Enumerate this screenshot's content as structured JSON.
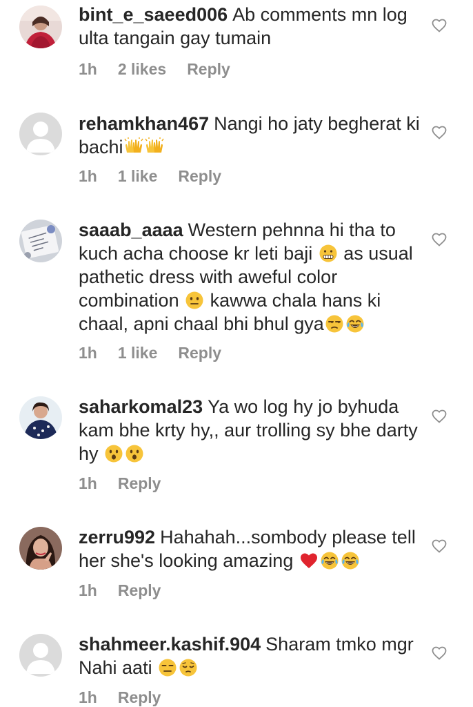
{
  "comments": [
    {
      "username": "bint_e_saeed006",
      "text_parts": [
        "Ab comments mn log ulta tangain gay tumain"
      ],
      "time": "1h",
      "likes": "2 likes",
      "reply": "Reply",
      "avatar": "photo-woman-red"
    },
    {
      "username": "rehamkhan467",
      "text_parts": [
        "Nangi ho jaty begherat ki bachi"
      ],
      "emojis": [
        "raising-hands",
        "raising-hands"
      ],
      "time": "1h",
      "likes": "1 like",
      "reply": "Reply",
      "avatar": "default-placeholder"
    },
    {
      "username": "saaab_aaaa",
      "text_parts": [
        "Western pehnna hi tha to kuch acha choose kr leti baji",
        "as usual pathetic dress with aweful color combination",
        "kawwa chala hans ki chaal, apni chaal bhi bhul gya"
      ],
      "time": "1h",
      "likes": "1 like",
      "reply": "Reply",
      "avatar": "photo-notebook"
    },
    {
      "username": "saharkomal23",
      "text_parts": [
        "Ya wo log hy jo byhuda kam bhe krty hy,, aur trolling sy bhe darty hy"
      ],
      "time": "1h",
      "reply": "Reply",
      "avatar": "photo-woman-smile"
    },
    {
      "username": "zerru992",
      "text_parts": [
        "Hahahah...sombody please tell her she's looking amazing"
      ],
      "time": "1h",
      "reply": "Reply",
      "avatar": "photo-woman-hand"
    },
    {
      "username": "shahmeer.kashif.904",
      "text_parts": [
        "Sharam tmko mgr Nahi aati"
      ],
      "time": "1h",
      "reply": "Reply",
      "avatar": "default-placeholder"
    }
  ],
  "icons": {
    "like": "heart-outline-icon"
  },
  "colors": {
    "text": "#262626",
    "meta": "#8e8e8e",
    "placeholder": "#dbdbdb"
  }
}
